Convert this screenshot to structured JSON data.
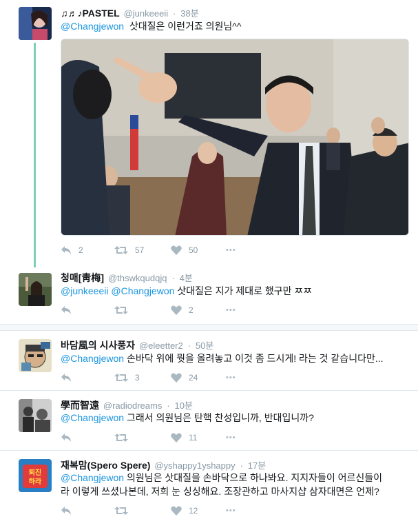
{
  "tweets": [
    {
      "name": "♫♬♪PASTEL",
      "handle": "@junkeeeii",
      "time": "38분",
      "mention": "@Changjewon",
      "text": "삿대질은 이런거죠 의원님^^",
      "reply_count": "2",
      "retweet_count": "57",
      "like_count": "50"
    },
    {
      "name": "청매[靑梅]",
      "handle": "@thswkqudqjq",
      "time": "4분",
      "mention1": "@junkeeeii",
      "mention2": "@Changjewon",
      "text": "삿대질은 지가 제대로 했구만 ㅉㅉ",
      "reply_count": "",
      "retweet_count": "",
      "like_count": "2"
    },
    {
      "name": "바담風의 시사풍자",
      "handle": "@eleetter2",
      "time": "50분",
      "mention": "@Changjewon",
      "text": "손바닥 위에 뭣을 올려놓고 이것 좀 드시게! 라는 것 같습니다만...",
      "reply_count": "",
      "retweet_count": "3",
      "like_count": "24"
    },
    {
      "name": "學而智遠",
      "handle": "@radiodreams",
      "time": "10분",
      "mention": "@Changjewon",
      "text": "그래서 의원님은 탄핵 찬성입니까, 반대입니까?",
      "reply_count": "",
      "retweet_count": "",
      "like_count": "11"
    },
    {
      "name": "재복맘(Spero Spere)",
      "handle": "@yshappy1yshappy",
      "time": "17분",
      "mention": "@Changjewon",
      "text_line1": "의원님은 삿대질을 손바닥으로 하나봐요. 지지자들이 어르신들이",
      "text_line2": "라 이렇게 쓰셨나본데, 저희 눈 싱싱해요. 조장관하고 마사지샵 삼자대면은 언제?",
      "reply_count": "",
      "retweet_count": "",
      "like_count": "12"
    }
  ],
  "avatar5_text": "퇴진 하라",
  "more_glyph": "•••",
  "time_sep": "·",
  "colors": {
    "mention": "#1b95e0",
    "action_icon": "#aab8c2",
    "thread_line": "#7fd0b3"
  }
}
